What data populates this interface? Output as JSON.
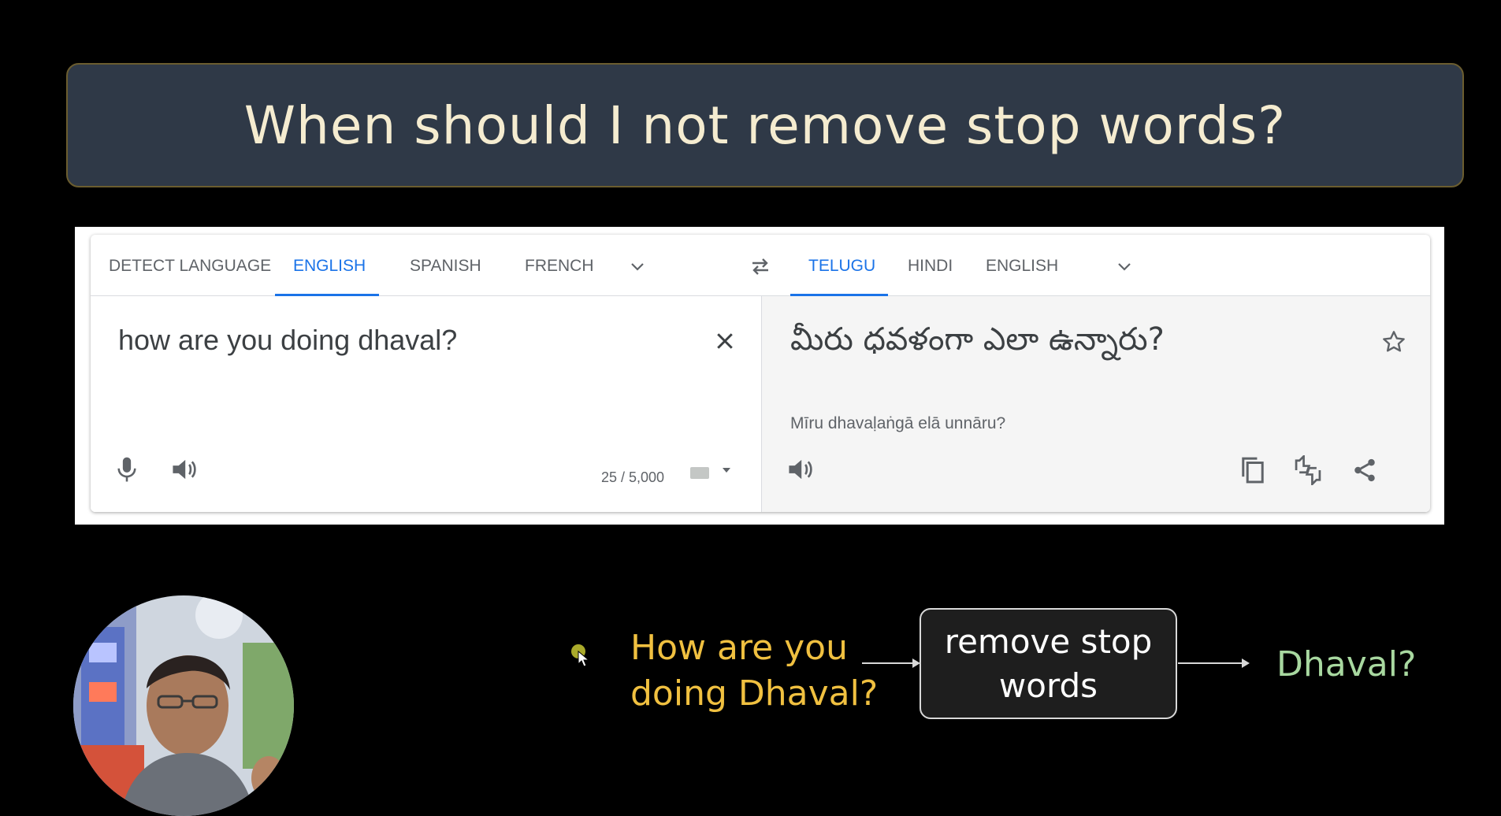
{
  "slide": {
    "title": "When should I not remove stop words?"
  },
  "translator": {
    "source_tabs": [
      {
        "label": "DETECT LANGUAGE",
        "active": false
      },
      {
        "label": "ENGLISH",
        "active": true
      },
      {
        "label": "SPANISH",
        "active": false
      },
      {
        "label": "FRENCH",
        "active": false
      }
    ],
    "target_tabs": [
      {
        "label": "TELUGU",
        "active": true
      },
      {
        "label": "HINDI",
        "active": false
      },
      {
        "label": "ENGLISH",
        "active": false
      }
    ],
    "source_text": "how are you doing dhaval?",
    "char_count": "25 / 5,000",
    "target_text": "మీరు ధవళంగా ఎలా ఉన్నారు?",
    "transliteration": "Mīru dhavaḷaṅgā elā unnāru?",
    "accent_color": "#1a73e8",
    "icons": [
      "chevron-down-icon",
      "swap-icon",
      "close-icon",
      "microphone-icon",
      "speaker-icon",
      "keyboard-icon",
      "star-icon",
      "copy-icon",
      "feedback-icon",
      "share-icon"
    ]
  },
  "diagram": {
    "input": "How are you doing Dhaval?",
    "input_line1": "How are you",
    "input_line2": "doing Dhaval?",
    "process_line1": "remove stop",
    "process_line2": "words",
    "output": "Dhaval?",
    "input_color": "#f0c040",
    "output_color": "#a8d8a0"
  }
}
